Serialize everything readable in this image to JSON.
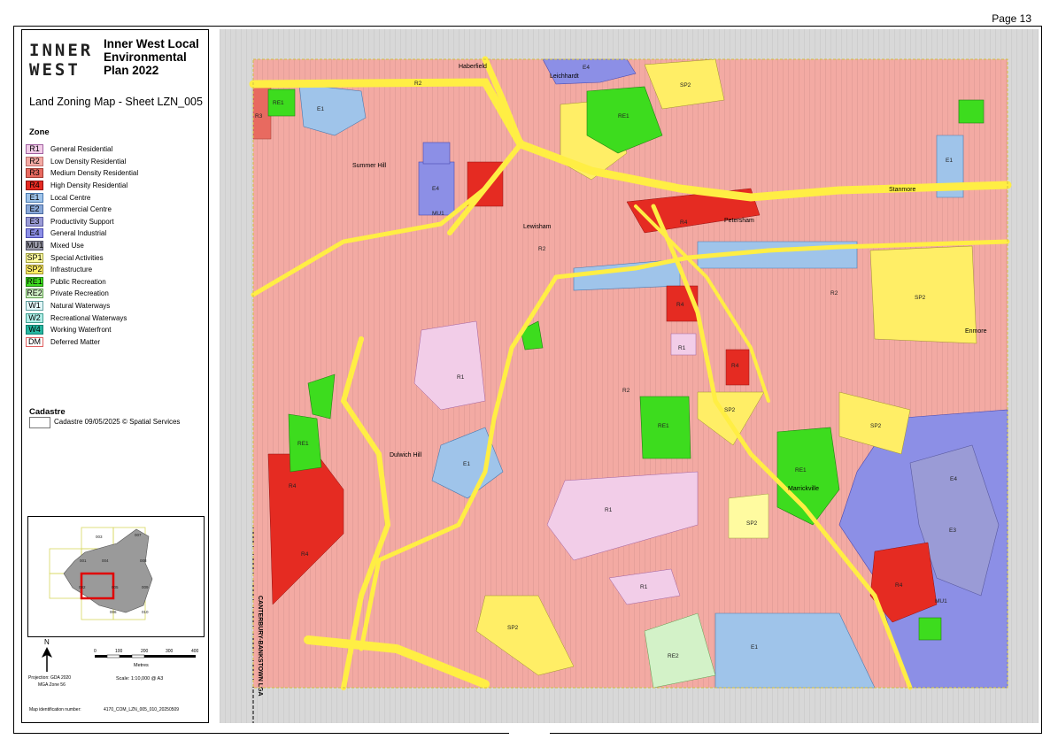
{
  "page_number": "Page 13",
  "logo": {
    "line1": "INNER",
    "line2": "WEST"
  },
  "title": "Inner West Local Environmental Plan 2022",
  "sheet": "Land Zoning Map - Sheet LZN_005",
  "zone_heading": "Zone",
  "zones": [
    {
      "code": "R1",
      "label": "General Residential",
      "color": "#f2cde8",
      "border": "#a060a0"
    },
    {
      "code": "R2",
      "label": "Low Density Residential",
      "color": "#f3aaa3",
      "border": "#c07070"
    },
    {
      "code": "R3",
      "label": "Medium Density Residential",
      "color": "#e86a60",
      "border": "#a03a30"
    },
    {
      "code": "R4",
      "label": "High Density Residential",
      "color": "#e52b22",
      "border": "#901010"
    },
    {
      "code": "E1",
      "label": "Local Centre",
      "color": "#9fc4ea",
      "border": "#4a7ab0"
    },
    {
      "code": "E2",
      "label": "Commercial Centre",
      "color": "#89a8d8",
      "border": "#4a6aa0"
    },
    {
      "code": "E3",
      "label": "Productivity Support",
      "color": "#9a9bd6",
      "border": "#5a5aa0"
    },
    {
      "code": "E4",
      "label": "General Industrial",
      "color": "#8c8fe6",
      "border": "#4a4ab0"
    },
    {
      "code": "MU1",
      "label": "Mixed Use",
      "color": "#9a9aa8",
      "border": "#505060"
    },
    {
      "code": "SP1",
      "label": "Special Activities",
      "color": "#fffba0",
      "border": "#a0a040"
    },
    {
      "code": "SP2",
      "label": "Infrastructure",
      "color": "#ffee66",
      "border": "#a09030"
    },
    {
      "code": "RE1",
      "label": "Public Recreation",
      "color": "#3ddc1e",
      "border": "#208010"
    },
    {
      "code": "RE2",
      "label": "Private Recreation",
      "color": "#d3f2c8",
      "border": "#60a050"
    },
    {
      "code": "W1",
      "label": "Natural Waterways",
      "color": "#e3f6f8",
      "border": "#60a0a0"
    },
    {
      "code": "W2",
      "label": "Recreational Waterways",
      "color": "#b0eee8",
      "border": "#40a090"
    },
    {
      "code": "W4",
      "label": "Working Waterfront",
      "color": "#26b6a0",
      "border": "#108070"
    },
    {
      "code": "DM",
      "label": "Deferred Matter",
      "color": "#ffffff",
      "border": "#e06060"
    }
  ],
  "cadastre": {
    "heading": "Cadastre",
    "label": "Cadastre 09/05/2025 © Spatial Services"
  },
  "keymap": {
    "sheets": [
      "003",
      "007",
      "001",
      "004",
      "008",
      "002",
      "005",
      "009",
      "006",
      "010"
    ],
    "current": "005"
  },
  "scale": {
    "ticks": [
      "0",
      "100",
      "200",
      "300",
      "400"
    ],
    "unit": "Metres",
    "text": "Scale: 1:10,000 @ A3",
    "north": "N",
    "projection": "Projection: GDA 2020",
    "zone": "MGA Zone 56"
  },
  "map_id_label": "Map identification number:",
  "map_id": "4170_COM_LZN_005_010_20250509",
  "lga_label": "CANTERBURY-BANKSTOWN LGA",
  "places": [
    "Haberfield",
    "Leichhardt",
    "Summer Hill",
    "Lewisham",
    "Petersham",
    "Stanmore",
    "Enmore",
    "Dulwich Hill",
    "Marrickville"
  ]
}
